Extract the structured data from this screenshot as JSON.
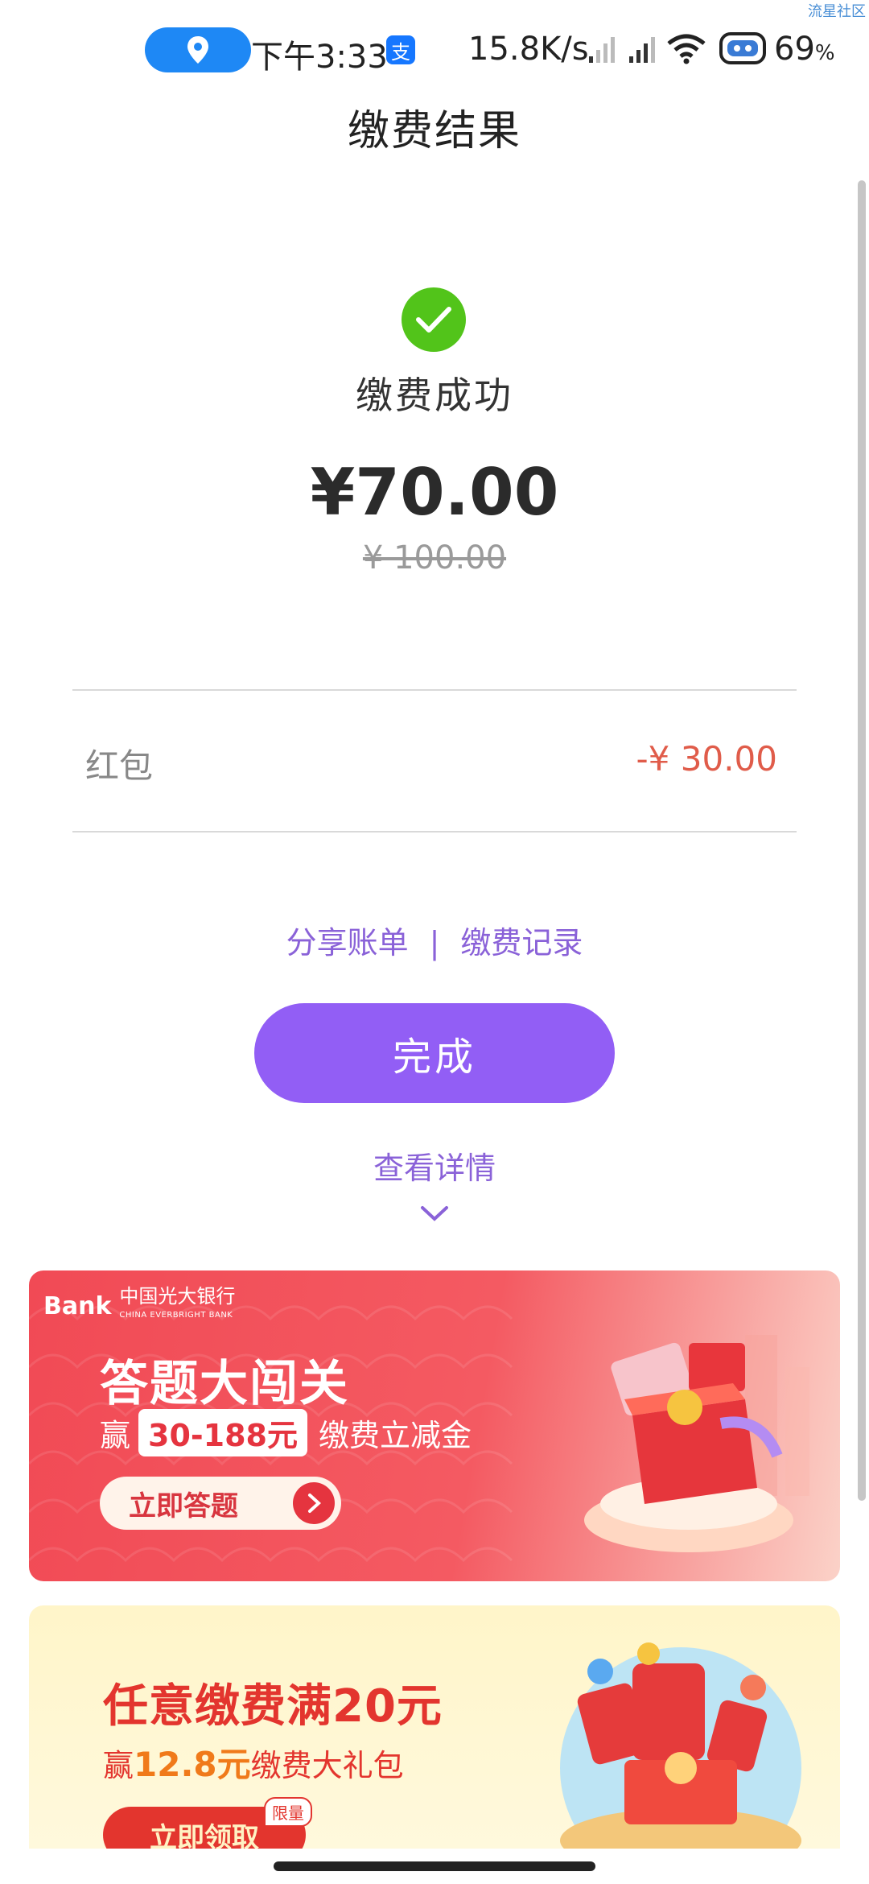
{
  "status_bar": {
    "time": "下午3:33",
    "net_speed": "15.8K/s",
    "battery": "69",
    "battery_unit": "%",
    "watermark": "流星社区",
    "alipay_glyph": "支"
  },
  "header": {
    "title": "缴费结果"
  },
  "result": {
    "status": "缴费成功",
    "amount": "¥70.00",
    "original_amount": "¥ 100.00"
  },
  "discount": {
    "label": "红包",
    "value": "-¥ 30.00"
  },
  "links": {
    "share": "分享账单",
    "separator": "|",
    "records": "缴费记录"
  },
  "done_button": "完成",
  "details_link": "查看详情",
  "banner1": {
    "bank_logo": "Bank",
    "bank_name": "中国光大银行",
    "bank_name_en": "CHINA EVERBRIGHT BANK",
    "title": "答题大闯关",
    "prefix": "赢",
    "highlight": "30-188元",
    "suffix": "缴费立减金",
    "button": "立即答题"
  },
  "banner2": {
    "title": "任意缴费满20元",
    "prefix": "赢",
    "highlight": "12.8元",
    "suffix": "缴费大礼包",
    "button": "立即领取",
    "tag": "限量"
  },
  "colors": {
    "accent": "#925ef5",
    "link": "#8a62d8",
    "success": "#52c41a",
    "discount": "#e05c4a",
    "banner_red": "#f14a55"
  }
}
